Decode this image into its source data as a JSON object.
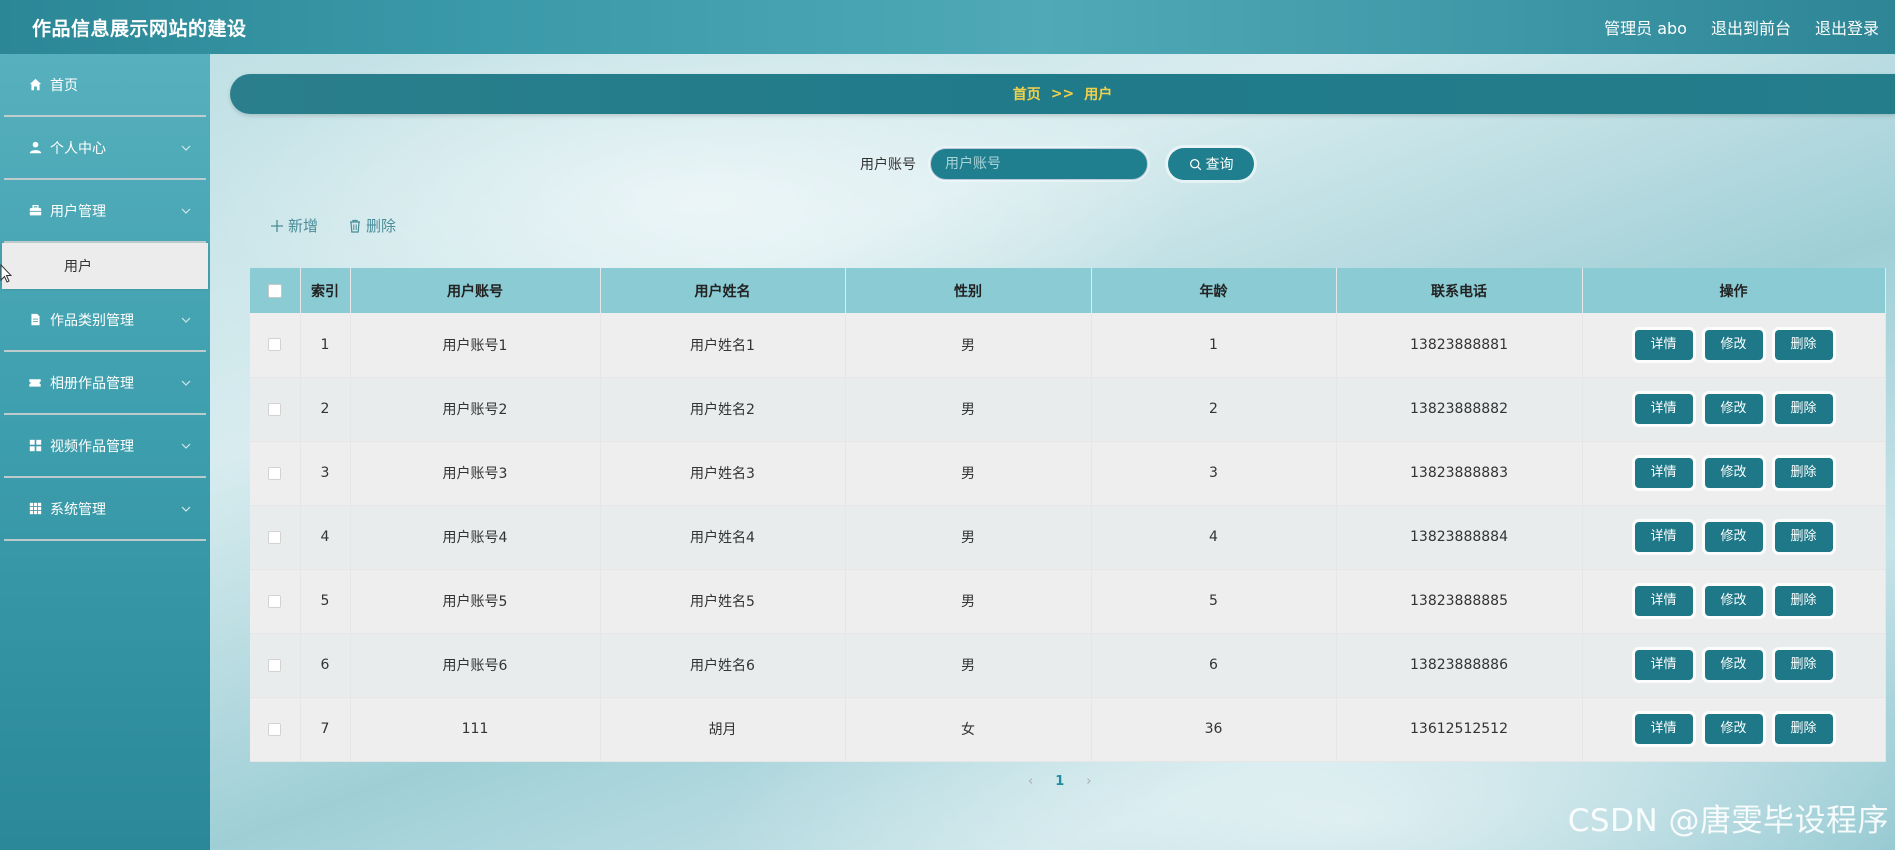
{
  "header": {
    "title": "作品信息展示网站的建设",
    "admin": "管理员 abo",
    "front": "退出到前台",
    "logout": "退出登录"
  },
  "sidebar": {
    "items": [
      {
        "label": "首页",
        "icon": "home-icon"
      },
      {
        "label": "个人中心",
        "icon": "user-icon"
      },
      {
        "label": "用户管理",
        "icon": "briefcase-icon"
      },
      {
        "label": "作品类别管理",
        "icon": "document-icon"
      },
      {
        "label": "相册作品管理",
        "icon": "ticket-icon"
      },
      {
        "label": "视频作品管理",
        "icon": "grid-icon"
      },
      {
        "label": "系统管理",
        "icon": "apps-icon"
      }
    ],
    "sub_active": "用户"
  },
  "breadcrumb": {
    "home": "首页",
    "sep": ">>",
    "current": "用户"
  },
  "search": {
    "label": "用户账号",
    "placeholder": "用户账号",
    "button": "查询"
  },
  "toolbar": {
    "add": "新增",
    "delete": "删除"
  },
  "table": {
    "headers": [
      "",
      "索引",
      "用户账号",
      "用户姓名",
      "性别",
      "年龄",
      "联系电话",
      "操作"
    ],
    "rows": [
      [
        "1",
        "用户账号1",
        "用户姓名1",
        "男",
        "1",
        "13823888881"
      ],
      [
        "2",
        "用户账号2",
        "用户姓名2",
        "男",
        "2",
        "13823888882"
      ],
      [
        "3",
        "用户账号3",
        "用户姓名3",
        "男",
        "3",
        "13823888883"
      ],
      [
        "4",
        "用户账号4",
        "用户姓名4",
        "男",
        "4",
        "13823888884"
      ],
      [
        "5",
        "用户账号5",
        "用户姓名5",
        "男",
        "5",
        "13823888885"
      ],
      [
        "6",
        "用户账号6",
        "用户姓名6",
        "男",
        "6",
        "13823888886"
      ],
      [
        "7",
        "111",
        "胡月",
        "女",
        "36",
        "13612512512"
      ]
    ],
    "actions": [
      "详情",
      "修改",
      "删除"
    ]
  },
  "pagination": {
    "prev": "‹",
    "page": "1",
    "next": "›"
  },
  "watermark": "CSDN @唐雯毕设程序"
}
